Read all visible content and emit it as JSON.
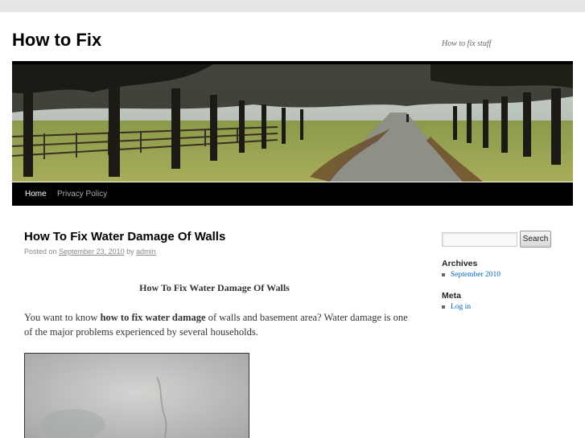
{
  "header": {
    "site_title": "How to Fix",
    "site_description": "How to fix stuff"
  },
  "nav": {
    "items": [
      {
        "label": "Home",
        "active": true
      },
      {
        "label": "Privacy Policy",
        "active": false
      }
    ]
  },
  "post": {
    "title": "How To Fix Water Damage Of Walls",
    "meta_prefix": "Posted on",
    "date": "September 23, 2010",
    "meta_by": "by",
    "author": "admin",
    "heading": "How To Fix Water Damage Of Walls",
    "para_before": "You want to know ",
    "para_bold": "how to fix water damage",
    "para_after": " of walls and basement area? Water damage is one of the major problems experienced by several households."
  },
  "sidebar": {
    "search_button": "Search",
    "search_placeholder": "",
    "archives_title": "Archives",
    "archives_items": [
      "September 2010"
    ],
    "meta_title": "Meta",
    "meta_items": [
      "Log in"
    ]
  },
  "colors": {
    "link": "#0066cc",
    "nav_bg": "#000000",
    "page_bg": "#ffffff"
  }
}
